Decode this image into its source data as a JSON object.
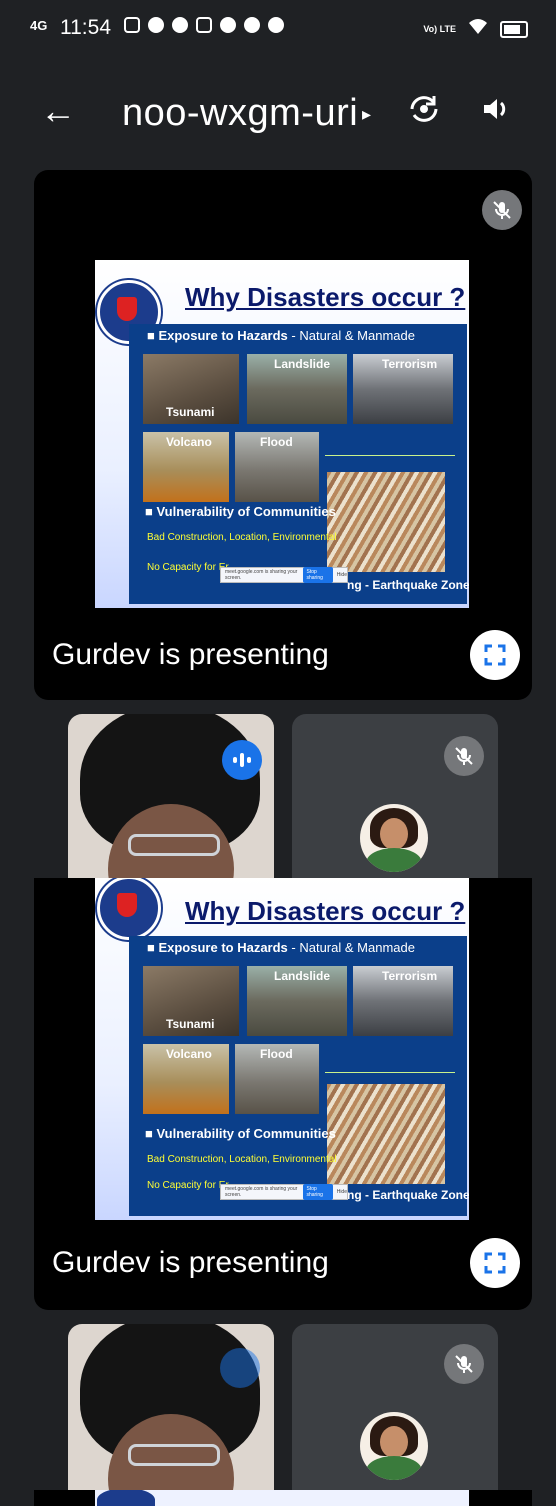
{
  "status_bar": {
    "signal": "4G",
    "time": "11:54",
    "notification_icons": [
      "gallery-icon",
      "chat-icon",
      "send-icon",
      "photo-icon",
      "a-icon",
      "check-icon",
      "circle-icon"
    ],
    "volte": "Vo) LTE",
    "wifi_icon": "wifi-icon",
    "battery_icon": "battery-icon"
  },
  "top_bar": {
    "back_icon": "arrow-left-icon",
    "meeting_code": "noo-wxgm-uri",
    "caret": "▸",
    "rotate_camera_icon": "camera-switch-icon",
    "speaker_icon": "speaker-icon"
  },
  "presentation": {
    "label": "Gurdev is presenting",
    "slide": {
      "title": "Why Disasters occur ?",
      "bullet1_bold": "Exposure to Hazards",
      "bullet1_rest": " - Natural & Manmade",
      "photos": [
        "Tsunami",
        "Landslide",
        "Terrorism",
        "Volcano",
        "Flood"
      ],
      "bullet2": "Vulnerability of Communities",
      "sub1": "Bad Construction, Location, Environmental",
      "sub2": "No Capacity for Er",
      "earthquake": "ng - Earthquake Zone",
      "share_notice": "meet.google.com is sharing your screen.",
      "share_stop": "Stop sharing",
      "share_hide": "Hide"
    }
  },
  "colors": {
    "background": "#1f2124",
    "tile": "#000000",
    "participant_tile": "#3c3f43",
    "accent": "#1a73e8",
    "slide_title": "#0b1a6b",
    "slide_panel": "#0b3f8a",
    "slide_yellow": "#ffff33"
  }
}
